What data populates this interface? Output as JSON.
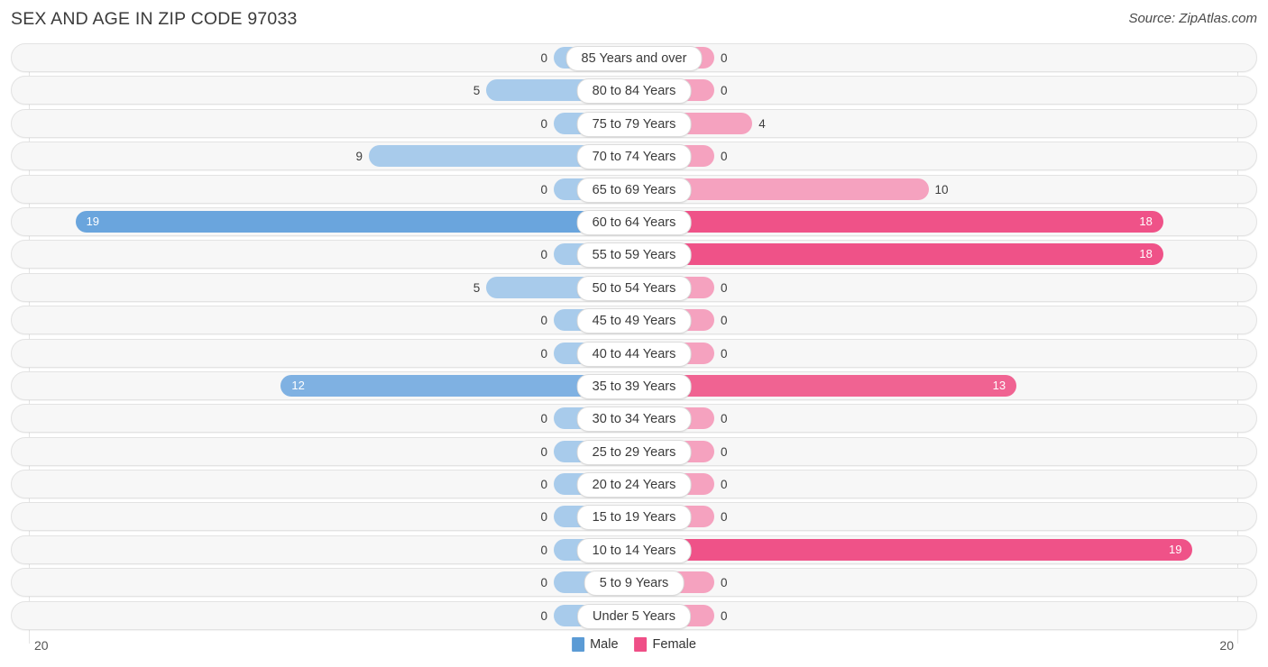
{
  "header": {
    "title": "SEX AND AGE IN ZIP CODE 97033",
    "source": "Source: ZipAtlas.com"
  },
  "legend": {
    "male_label": "Male",
    "female_label": "Female",
    "male_color": "#5b9bd5",
    "female_color": "#ef4f87"
  },
  "axis": {
    "left_label": "20",
    "right_label": "20"
  },
  "chart_data": {
    "type": "bar",
    "title": "SEX AND AGE IN ZIP CODE 97033",
    "subtitle": "Source: ZipAtlas.com",
    "orientation": "horizontal-diverging",
    "xlabel": "",
    "ylabel": "",
    "xlim": [
      20,
      20
    ],
    "axis_max": 20,
    "grid": true,
    "legend_position": "bottom-center",
    "categories": [
      "85 Years and over",
      "80 to 84 Years",
      "75 to 79 Years",
      "70 to 74 Years",
      "65 to 69 Years",
      "60 to 64 Years",
      "55 to 59 Years",
      "50 to 54 Years",
      "45 to 49 Years",
      "40 to 44 Years",
      "35 to 39 Years",
      "30 to 34 Years",
      "25 to 29 Years",
      "20 to 24 Years",
      "15 to 19 Years",
      "10 to 14 Years",
      "5 to 9 Years",
      "Under 5 Years"
    ],
    "series": [
      {
        "name": "Male",
        "color": "#5b9bd5",
        "values": [
          0,
          5,
          0,
          9,
          0,
          19,
          0,
          5,
          0,
          0,
          12,
          0,
          0,
          0,
          0,
          0,
          0,
          0
        ]
      },
      {
        "name": "Female",
        "color": "#ef4f87",
        "values": [
          0,
          0,
          4,
          0,
          10,
          18,
          18,
          0,
          0,
          0,
          13,
          0,
          0,
          0,
          0,
          19,
          0,
          0
        ]
      }
    ]
  },
  "rows": [
    {
      "label": "85 Years and over",
      "male": 0,
      "female": 0
    },
    {
      "label": "80 to 84 Years",
      "male": 5,
      "female": 0
    },
    {
      "label": "75 to 79 Years",
      "male": 0,
      "female": 4
    },
    {
      "label": "70 to 74 Years",
      "male": 9,
      "female": 0
    },
    {
      "label": "65 to 69 Years",
      "male": 0,
      "female": 10
    },
    {
      "label": "60 to 64 Years",
      "male": 19,
      "female": 18
    },
    {
      "label": "55 to 59 Years",
      "male": 0,
      "female": 18
    },
    {
      "label": "50 to 54 Years",
      "male": 5,
      "female": 0
    },
    {
      "label": "45 to 49 Years",
      "male": 0,
      "female": 0
    },
    {
      "label": "40 to 44 Years",
      "male": 0,
      "female": 0
    },
    {
      "label": "35 to 39 Years",
      "male": 12,
      "female": 13
    },
    {
      "label": "30 to 34 Years",
      "male": 0,
      "female": 0
    },
    {
      "label": "25 to 29 Years",
      "male": 0,
      "female": 0
    },
    {
      "label": "20 to 24 Years",
      "male": 0,
      "female": 0
    },
    {
      "label": "15 to 19 Years",
      "male": 0,
      "female": 0
    },
    {
      "label": "10 to 14 Years",
      "male": 0,
      "female": 19
    },
    {
      "label": "5 to 9 Years",
      "male": 0,
      "female": 0
    },
    {
      "label": "Under 5 Years",
      "male": 0,
      "female": 0
    }
  ]
}
